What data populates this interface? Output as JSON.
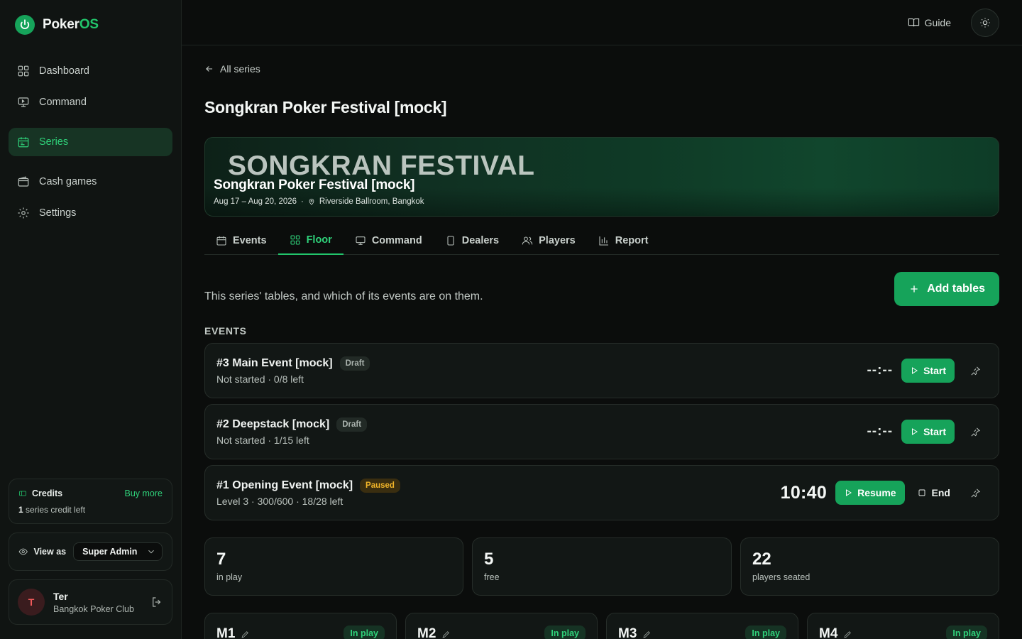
{
  "brand": {
    "name_main": "Poker",
    "name_accent": "OS"
  },
  "sidebar": {
    "items": [
      {
        "label": "Dashboard",
        "icon": "grid-icon"
      },
      {
        "label": "Command",
        "icon": "monitor-icon"
      },
      {
        "label": "Series",
        "icon": "calendar-icon",
        "active": true
      },
      {
        "label": "Cash games",
        "icon": "wallet-icon"
      },
      {
        "label": "Settings",
        "icon": "gear-icon"
      }
    ],
    "credits": {
      "title": "Credits",
      "buy_more": "Buy more",
      "count": "1",
      "count_suffix": "series credit left"
    },
    "view_as": {
      "label": "View as",
      "selected": "Super Admin"
    },
    "user": {
      "initial": "T",
      "name": "Ter",
      "club": "Bangkok Poker Club"
    }
  },
  "topbar": {
    "guide": "Guide"
  },
  "page": {
    "back": "All series",
    "title": "Songkran Poker Festival [mock]",
    "banner": {
      "art_text": "SONGKRAN FESTIVAL",
      "name": "Songkran Poker Festival [mock]",
      "dates": "Aug 17 – Aug 20, 2026",
      "separator": "·",
      "venue": "Riverside Ballroom, Bangkok"
    },
    "tabs": [
      {
        "label": "Events"
      },
      {
        "label": "Floor",
        "active": true
      },
      {
        "label": "Command"
      },
      {
        "label": "Dealers"
      },
      {
        "label": "Players"
      },
      {
        "label": "Report"
      }
    ],
    "description": "This series' tables, and which of its events are on them.",
    "add_tables": "Add tables",
    "events_label": "EVENTS",
    "events": [
      {
        "name": "#3 Main Event [mock]",
        "badge": "Draft",
        "sub": "Not started · 0/8 left",
        "clock": "--:--",
        "action": "Start"
      },
      {
        "name": "#2 Deepstack [mock]",
        "badge": "Draft",
        "sub": "Not started · 1/15 left",
        "clock": "--:--",
        "action": "Start"
      },
      {
        "name": "#1 Opening Event [mock]",
        "badge": "Paused",
        "sub": "Level 3 · 300/600 · 18/28 left",
        "clock": "10:40",
        "action": "Resume",
        "secondary": "End"
      }
    ],
    "stats": [
      {
        "num": "7",
        "label": "in play"
      },
      {
        "num": "5",
        "label": "free"
      },
      {
        "num": "22",
        "label": "players seated"
      }
    ],
    "tables": [
      {
        "name": "M1",
        "status": "In play"
      },
      {
        "name": "M2",
        "status": "In play"
      },
      {
        "name": "M3",
        "status": "In play"
      },
      {
        "name": "M4",
        "status": "In play"
      }
    ]
  },
  "colors": {
    "accent": "#16a35a",
    "accent_text": "#2fd27a",
    "paused": "#f0b429",
    "background": "#0b0d0c"
  }
}
